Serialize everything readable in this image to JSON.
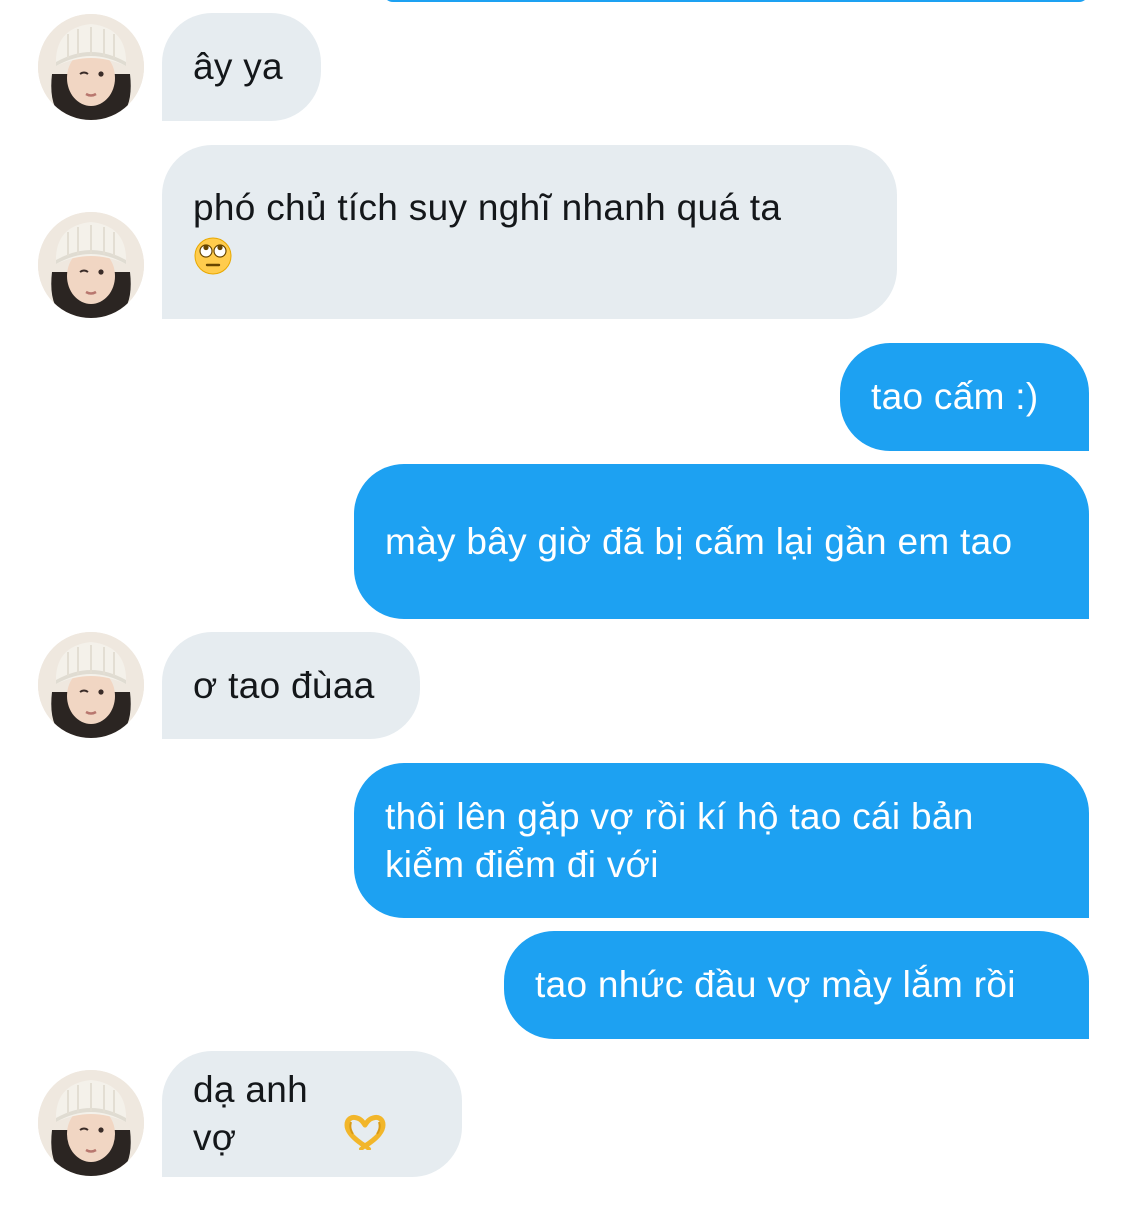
{
  "colors": {
    "outgoing_bubble": "#1da1f2",
    "incoming_bubble": "#e6ecf0",
    "incoming_text": "#14171a",
    "outgoing_text": "#ffffff"
  },
  "messages": [
    {
      "direction": "incoming",
      "text": "ây ya"
    },
    {
      "direction": "incoming",
      "text": "phó chủ tích suy nghĩ nhanh quá ta",
      "emoji": "face-with-rolling-eyes-icon"
    },
    {
      "direction": "outgoing",
      "text": "tao cấm :)"
    },
    {
      "direction": "outgoing",
      "text": "mày bây giờ đã bị cấm lại gần em tao"
    },
    {
      "direction": "incoming",
      "text": "ơ tao đùaa"
    },
    {
      "direction": "outgoing",
      "text": "thôi lên gặp vợ rồi kí hộ tao cái bản kiểm điểm đi với"
    },
    {
      "direction": "outgoing",
      "text": "tao nhức đầu vợ mày lắm rồi"
    },
    {
      "direction": "incoming",
      "text": "dạ anh vợ",
      "emoji": "heart-hands-icon"
    }
  ]
}
